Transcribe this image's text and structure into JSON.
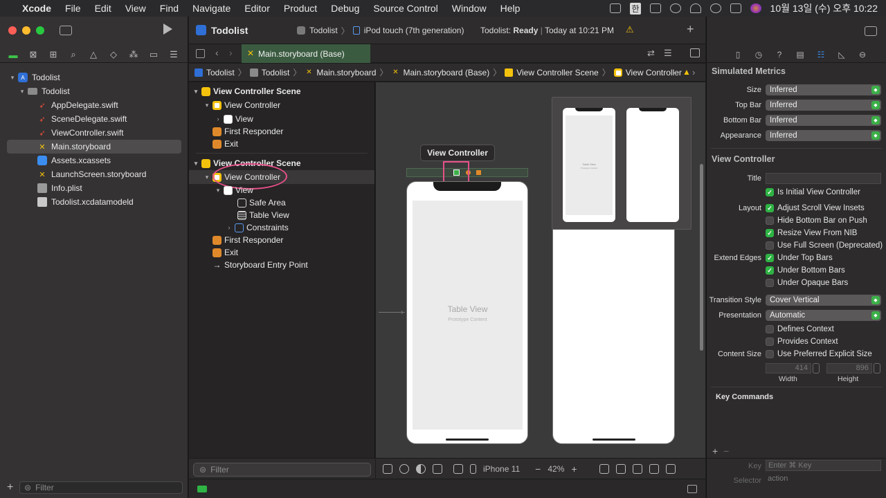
{
  "menubar": {
    "app": "Xcode",
    "items": [
      "File",
      "Edit",
      "View",
      "Find",
      "Navigate",
      "Editor",
      "Product",
      "Debug",
      "Source Control",
      "Window",
      "Help"
    ],
    "clock": "10월 13일 (수) 오후 10:22",
    "input_source": "한"
  },
  "toolbar": {
    "scheme": "Todolist",
    "device": "iPod touch (7th generation)",
    "status_app": "Todolist:",
    "status_state": "Ready",
    "status_time": "Today at 10:21 PM",
    "warning": "⚠",
    "add": "+"
  },
  "navigator": {
    "items": [
      {
        "label": "Todolist",
        "level": 0,
        "kind": "project"
      },
      {
        "label": "Todolist",
        "level": 1,
        "kind": "folder"
      },
      {
        "label": "AppDelegate.swift",
        "level": 2,
        "kind": "swift"
      },
      {
        "label": "SceneDelegate.swift",
        "level": 2,
        "kind": "swift"
      },
      {
        "label": "ViewController.swift",
        "level": 2,
        "kind": "swift"
      },
      {
        "label": "Main.storyboard",
        "level": 2,
        "kind": "storyboard"
      },
      {
        "label": "Assets.xcassets",
        "level": 2,
        "kind": "assets"
      },
      {
        "label": "LaunchScreen.storyboard",
        "level": 2,
        "kind": "storyboard"
      },
      {
        "label": "Info.plist",
        "level": 2,
        "kind": "plist"
      },
      {
        "label": "Todolist.xcdatamodeld",
        "level": 2,
        "kind": "datamodel"
      }
    ],
    "filter_placeholder": "Filter",
    "add": "+"
  },
  "tab": {
    "label": "Main.storyboard (Base)"
  },
  "jumpbar": {
    "crumbs": [
      "Todolist",
      "Todolist",
      "Main.storyboard",
      "Main.storyboard (Base)",
      "View Controller Scene",
      "View Controller"
    ]
  },
  "outline": {
    "rows": [
      {
        "label": "View Controller Scene",
        "indent": 0,
        "disc": "▾",
        "icon": "scene",
        "bold": true
      },
      {
        "label": "View Controller",
        "indent": 1,
        "disc": "▾",
        "icon": "vc"
      },
      {
        "label": "View",
        "indent": 2,
        "disc": "›",
        "icon": "view"
      },
      {
        "label": "First Responder",
        "indent": 1,
        "disc": "",
        "icon": "fr"
      },
      {
        "label": "Exit",
        "indent": 1,
        "disc": "",
        "icon": "exit"
      },
      {
        "label": "View Controller Scene",
        "indent": 0,
        "disc": "▾",
        "icon": "scene",
        "bold": true
      },
      {
        "label": "View Controller",
        "indent": 1,
        "disc": "▾",
        "icon": "vc",
        "circled": true
      },
      {
        "label": "View",
        "indent": 2,
        "disc": "▾",
        "icon": "view"
      },
      {
        "label": "Safe Area",
        "indent": 3,
        "disc": "",
        "icon": "safearea"
      },
      {
        "label": "Table View",
        "indent": 3,
        "disc": "",
        "icon": "table"
      },
      {
        "label": "Constraints",
        "indent": 3,
        "disc": "›",
        "icon": "constraints"
      },
      {
        "label": "First Responder",
        "indent": 1,
        "disc": "",
        "icon": "fr"
      },
      {
        "label": "Exit",
        "indent": 1,
        "disc": "",
        "icon": "exit"
      },
      {
        "label": "Storyboard Entry Point",
        "indent": 1,
        "disc": "",
        "icon": "arrow"
      }
    ],
    "filter_placeholder": "Filter"
  },
  "canvas": {
    "tooltip": "View Controller",
    "table_view_title": "Table View",
    "table_view_sub": "Prototype Content",
    "preview_text_1": "Table View",
    "preview_text_2": "Prototype Content"
  },
  "canvas_bottom": {
    "device": "iPhone 11",
    "zoom": "42%",
    "zoom_out": "−",
    "zoom_in": "+"
  },
  "inspector": {
    "simulated_metrics_title": "Simulated Metrics",
    "size_label": "Size",
    "size_value": "Inferred",
    "topbar_label": "Top Bar",
    "topbar_value": "Inferred",
    "bottombar_label": "Bottom Bar",
    "bottombar_value": "Inferred",
    "appearance_label": "Appearance",
    "appearance_value": "Inferred",
    "vc_title": "View Controller",
    "title_label": "Title",
    "is_initial": "Is Initial View Controller",
    "layout_label": "Layout",
    "adjust_insets": "Adjust Scroll View Insets",
    "hide_bottom": "Hide Bottom Bar on Push",
    "resize_nib": "Resize View From NIB",
    "full_screen": "Use Full Screen (Deprecated)",
    "extend_label": "Extend Edges",
    "under_top": "Under Top Bars",
    "under_bottom": "Under Bottom Bars",
    "under_opaque": "Under Opaque Bars",
    "transition_label": "Transition Style",
    "transition_value": "Cover Vertical",
    "presentation_label": "Presentation",
    "presentation_value": "Automatic",
    "defines_context": "Defines Context",
    "provides_context": "Provides Context",
    "content_size_label": "Content Size",
    "preferred_size": "Use Preferred Explicit Size",
    "width_value": "414",
    "height_value": "896",
    "width_label": "Width",
    "height_label": "Height",
    "key_commands": "Key Commands",
    "key_placeholder": "Enter ⌘ Key",
    "key_col": "Key",
    "selector_col": "Selector",
    "action_value": "action",
    "add": "+",
    "remove": "−"
  },
  "colors": {
    "accent_green": "#2fb344",
    "highlight_pink": "#e8508a",
    "vc_yellow": "#f4c20d",
    "tab_green": "#3b5b41"
  }
}
